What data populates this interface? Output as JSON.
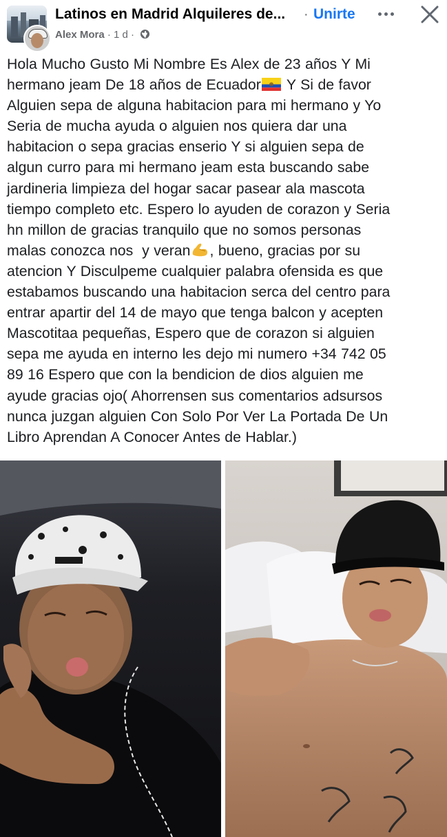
{
  "header": {
    "group_name": "Latinos en Madrid Alquileres de...",
    "separator": "·",
    "join_label": "Unirte",
    "author": "Alex Mora",
    "time": "· 1 d ·",
    "icons": {
      "more": "more-options-icon",
      "close": "close-icon",
      "audience": "globe-icon"
    }
  },
  "post": {
    "line_1": "Hola Mucho Gusto Mi Nombre Es Alex de 23 años Y Mi",
    "line_2a": "hermano jeam De 18 años de Ecuador",
    "line_2b": " Y Si de favor",
    "line_3": "Alguien sepa de alguna habitacion para mi hermano y Yo",
    "line_4": "Seria de mucha ayuda o alguien nos quiera dar una",
    "line_5": "habitacion o sepa gracias enserio Y si alguien sepa de",
    "line_6": "algun curro para mi hermano jeam esta buscando sabe",
    "line_7": "jardineria limpieza del hogar sacar pasear ala mascota",
    "line_8": "tiempo completo etc. Espero lo ayuden de corazon y Seria",
    "line_9": "hn millon de gracias tranquilo que no somos personas",
    "line_10a": "malas conozca nos  y veran",
    "line_10b": ", bueno, gracias por su",
    "line_11": "atencion Y Disculpeme cualquier palabra ofensida es que",
    "line_12": "estabamos buscando una habitacion serca del centro para",
    "line_13": "entrar apartir del 14 de mayo que tenga balcon y acepten",
    "line_14": "Mascotitaa pequeñas, Espero que de corazon si alguien",
    "line_15": "sepa me ayuda en interno les dejo mi numero +34 742 05",
    "line_16": "89 16 Espero que con la bendicion de dios alguien me",
    "line_17": "ayude gracias ojo( Ahorrensen sus comentarios adsursos",
    "line_18": "nunca juzgan alguien Con Solo Por Ver La Portada De Un",
    "line_19": "Libro Aprendan A Conocer Antes de Hablar.)",
    "emojis": [
      "flag-ecuador-icon",
      "flexed-biceps-icon"
    ]
  },
  "colors": {
    "link": "#1877f2",
    "text": "#1c1e21",
    "meta": "#65676b"
  }
}
